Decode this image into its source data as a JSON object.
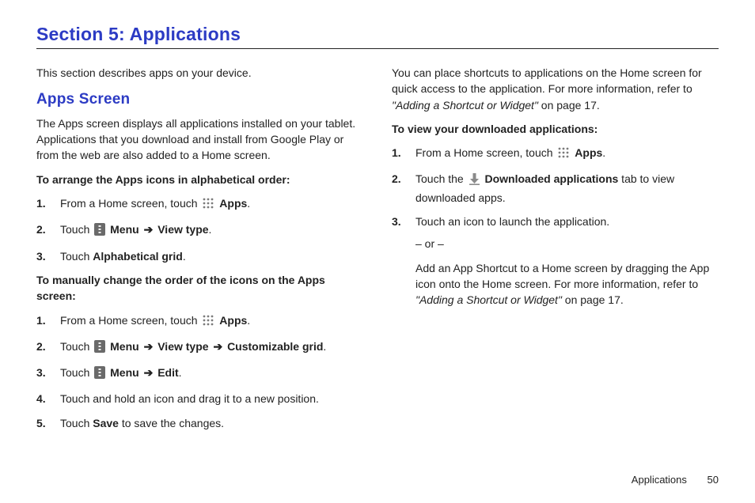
{
  "section_title": "Section 5: Applications",
  "left": {
    "intro": "This section describes apps on your device.",
    "subhead": "Apps Screen",
    "subhead_desc": "The Apps screen displays all applications installed on your tablet. Applications that you download and install from Google Play or from the web are also added to a Home screen.",
    "arrange_heading": "To arrange the Apps icons in alphabetical order:",
    "arrange_steps": {
      "s1_a": "From a Home screen, touch ",
      "s1_apps": "Apps",
      "s2_touch": "Touch ",
      "s2_menu": "Menu",
      "s2_view": "View type",
      "s3_touch": "Touch ",
      "s3_alpha": "Alphabetical grid"
    },
    "manual_heading": "To manually change the order of the icons on the Apps screen:",
    "manual_steps": {
      "s1_a": "From a Home screen, touch ",
      "s1_apps": "Apps",
      "s2_touch": "Touch ",
      "s2_menu": "Menu",
      "s2_view": "View type",
      "s2_custom": "Customizable grid",
      "s3_touch": "Touch ",
      "s3_menu": "Menu",
      "s3_edit": "Edit",
      "s4": "Touch and hold an icon and drag it to a new position.",
      "s5_a": "Touch ",
      "s5_save": "Save",
      "s5_b": " to save the changes."
    }
  },
  "right": {
    "intro_a": "You can place shortcuts to applications on the Home screen for quick access to the application. For more information, refer to ",
    "intro_ref": "\"Adding a Shortcut or Widget\"",
    "intro_b": " on page 17.",
    "view_heading": "To view your downloaded applications:",
    "steps": {
      "s1_a": "From a Home screen, touch ",
      "s1_apps": "Apps",
      "s2_a": "Touch the ",
      "s2_dl": "Downloaded applications",
      "s2_b": " tab to view downloaded apps.",
      "s3": "Touch an icon to launch the application."
    },
    "or": "– or –",
    "alt_a": "Add an App Shortcut to a Home screen by dragging the App icon onto the Home screen. For more information, refer to ",
    "alt_ref": "\"Adding a Shortcut or Widget\"",
    "alt_b": " on page 17."
  },
  "footer": {
    "label": "Applications",
    "page": "50"
  },
  "nums": {
    "n1": "1.",
    "n2": "2.",
    "n3": "3.",
    "n4": "4.",
    "n5": "5."
  },
  "glyph": {
    "arrow": "➔",
    "dot": "."
  }
}
